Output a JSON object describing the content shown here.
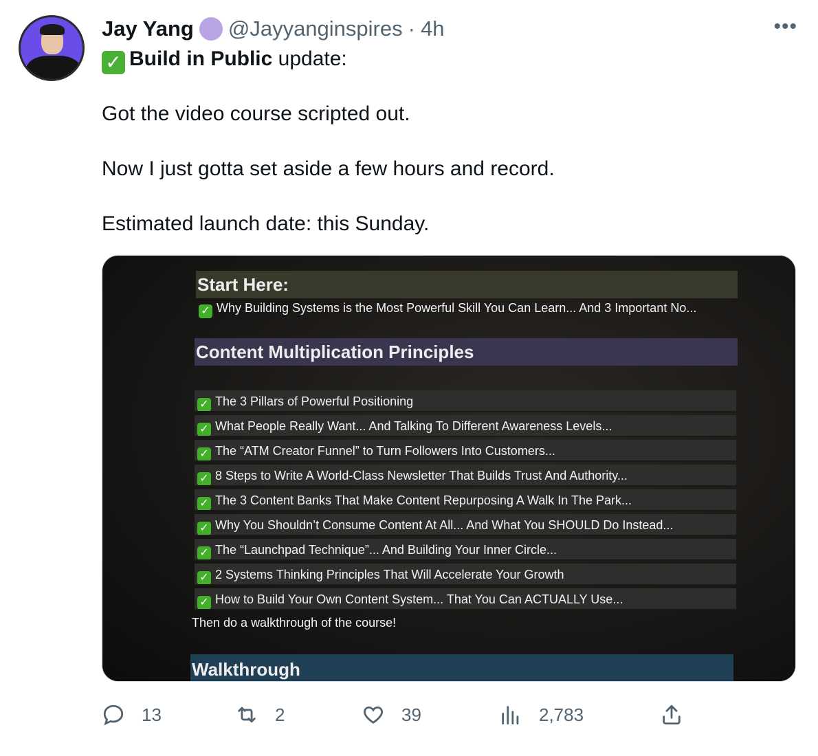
{
  "tweet": {
    "display_name": "Jay Yang",
    "handle": "@Jayyanginspires",
    "separator": "·",
    "time": "4h",
    "more": "•••",
    "check_glyph": "✓",
    "line1_bold": "Build in Public",
    "line1_rest": " update:",
    "line2": "Got the video course scripted out.",
    "line3": "Now I just gotta set aside a few hours and record.",
    "line4": "Estimated launch date: this Sunday."
  },
  "media": {
    "section_start": "Start Here:",
    "start_item": "Why Building Systems is the Most Powerful Skill You Can Learn... And 3 Important No...",
    "section_content": "Content Multiplication Principles",
    "items": [
      "The 3 Pillars of Powerful Positioning",
      "What People Really Want... And Talking To Different Awareness Levels...",
      "The “ATM Creator Funnel” to Turn Followers Into Customers...",
      "8 Steps to Write A World-Class Newsletter That Builds Trust And Authority...",
      "The 3 Content Banks That Make Content Repurposing A Walk In The Park...",
      "Why You Shouldn’t Consume Content At All... And What You SHOULD Do Instead...",
      "The “Launchpad Technique”... And Building Your Inner Circle...",
      "2 Systems Thinking Principles That Will Accelerate Your Growth",
      "How to Build Your Own Content System... That You Can ACTUALLY Use..."
    ],
    "note": "Then do a walkthrough of the course!",
    "section_walk": "Walkthrough"
  },
  "actions": {
    "replies": "13",
    "retweets": "2",
    "likes": "39",
    "views": "2,783"
  },
  "colors": {
    "accent_check": "#4ab035",
    "muted": "#536471",
    "verified": "#b9a5e3"
  }
}
